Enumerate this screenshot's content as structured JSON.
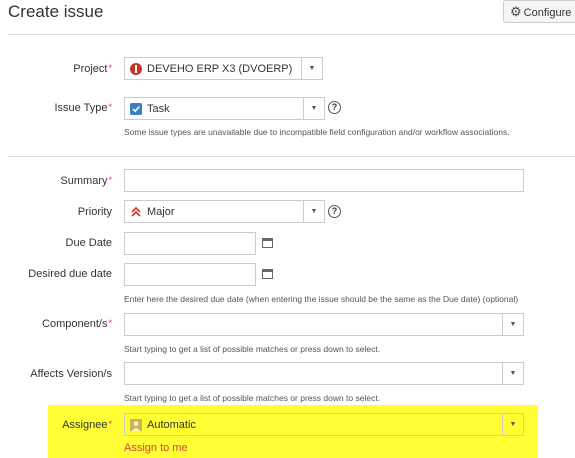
{
  "header": {
    "title": "Create issue",
    "configure_label": "Configure"
  },
  "form": {
    "project": {
      "label": "Project",
      "value": "DEVEHO ERP X3 (DVOERP)"
    },
    "issue_type": {
      "label": "Issue Type",
      "value": "Task",
      "hint": "Some issue types are unavailable due to incompatible field configuration and/or workflow associations."
    },
    "summary": {
      "label": "Summary",
      "value": ""
    },
    "priority": {
      "label": "Priority",
      "value": "Major"
    },
    "due_date": {
      "label": "Due Date",
      "value": ""
    },
    "desired_due_date": {
      "label": "Desired due date",
      "value": "",
      "hint": "Enter here the desired due date (when entering the issue should be the same as the Due date) (optional)"
    },
    "components": {
      "label": "Component/s",
      "value": "",
      "hint": "Start typing to get a list of possible matches or press down to select."
    },
    "affects_versions": {
      "label": "Affects Version/s",
      "value": "",
      "hint": "Start typing to get a list of possible matches or press down to select."
    },
    "assignee": {
      "label": "Assignee",
      "value": "Automatic",
      "assign_to_me": "Assign to me"
    }
  },
  "colors": {
    "required": "#d04437",
    "highlight": "#ffff33",
    "task_icon": "#3b7fc4"
  }
}
